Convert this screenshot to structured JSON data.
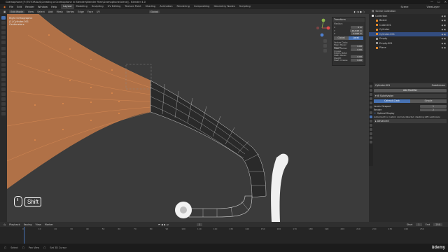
{
  "window": {
    "title": "Gramophone [F:\\TUTORIALS\\Creating a Gramophone in Blender\\Blender Files\\Gramophone.blend] - Blender 4.0"
  },
  "menubar": {
    "items": [
      "File",
      "Edit",
      "Render",
      "Window",
      "Help"
    ],
    "workspaces": [
      "Layout",
      "Modeling",
      "Sculpting",
      "UV Editing",
      "Texture Paint",
      "Shading",
      "Animation",
      "Rendering",
      "Compositing",
      "Geometry Nodes",
      "Scripting"
    ],
    "active_workspace": "Layout",
    "scene": "Scene",
    "view_layer": "ViewLayer"
  },
  "viewport_header": {
    "mode": "Edit Mode",
    "menus": [
      "View",
      "Select",
      "Add",
      "Mesh",
      "Vertex",
      "Edge",
      "Face",
      "UV"
    ],
    "orientation": "Global"
  },
  "viewport": {
    "view_name": "Right Orthographic",
    "object_info": "(1) Cylinder.001",
    "units": "Centimeters"
  },
  "npanel": {
    "header": "Transform",
    "section_median": "Median:",
    "rows": [
      {
        "label": "X",
        "value": "0 m"
      },
      {
        "label": "Y",
        "value": "-16.843 m"
      },
      {
        "label": "Z",
        "value": "9.993 m"
      }
    ],
    "toggle_global": "Global",
    "toggle_local": "Local",
    "vertex_data": "Vertex Data:",
    "vertex_rows": [
      {
        "label": "Mean Bevel Weight",
        "value": "0.00"
      },
      {
        "label": "Mean Vertex Crease",
        "value": "0.00"
      }
    ],
    "edge_data": "Edges Data:",
    "edge_rows": [
      {
        "label": "Mean Bevel Weight",
        "value": "0.00"
      },
      {
        "label": "Mean Crease",
        "value": "0.00"
      }
    ]
  },
  "outliner": {
    "header": "Scene Collection",
    "items": [
      {
        "name": "Collection",
        "color": "#e0e0e0",
        "selected": false
      },
      {
        "name": "Bezier",
        "color": "#e58a2b",
        "selected": false
      },
      {
        "name": "Cube.001",
        "color": "#e58a2b",
        "selected": false
      },
      {
        "name": "Cylinder",
        "color": "#e58a2b",
        "selected": false
      },
      {
        "name": "Cylinder.001",
        "color": "#e58a2b",
        "selected": true
      },
      {
        "name": "Empty",
        "color": "#9a9a9a",
        "selected": false
      },
      {
        "name": "Empty.001",
        "color": "#9a9a9a",
        "selected": false
      },
      {
        "name": "Plane",
        "color": "#e58a2b",
        "selected": false
      }
    ]
  },
  "properties": {
    "object_name": "Cylinder.001",
    "modifier_name": "Subdivision",
    "add_modifier": "Add Modifier",
    "modifier_panel": "Subdivision",
    "seg_options": [
      "Catmull-Clark",
      "Simple"
    ],
    "seg_active": "Catmull-Clark",
    "rows": [
      {
        "label": "Levels Viewport",
        "value": "1"
      },
      {
        "label": "Render",
        "value": "2"
      }
    ],
    "optimal_display": "Optimal Display",
    "note": "Autosmooth or custom normals detected, disabling GPU subdivision",
    "advanced": "Advanced"
  },
  "timeline": {
    "menus": [
      "Playback",
      "Keying",
      "View",
      "Marker"
    ],
    "ticks": [
      "0",
      "10",
      "20",
      "30",
      "40",
      "50",
      "60",
      "70",
      "80",
      "90",
      "100",
      "110",
      "120",
      "130",
      "140",
      "150",
      "160",
      "170",
      "180",
      "190",
      "200",
      "210",
      "220",
      "230",
      "240",
      "250"
    ],
    "start_label": "Start",
    "start": "1",
    "end_label": "End",
    "end": "250",
    "current_frame": "1"
  },
  "statusbar": {
    "items": [
      "Select",
      "Pan View",
      "Set 3D Cursor"
    ]
  },
  "overlay_key": {
    "key": "Shift"
  },
  "watermark": "ûdemy",
  "colors": {
    "accent": "#4772b3",
    "selection_orange": "#e58a2b",
    "viewport_bg": "#000000"
  }
}
